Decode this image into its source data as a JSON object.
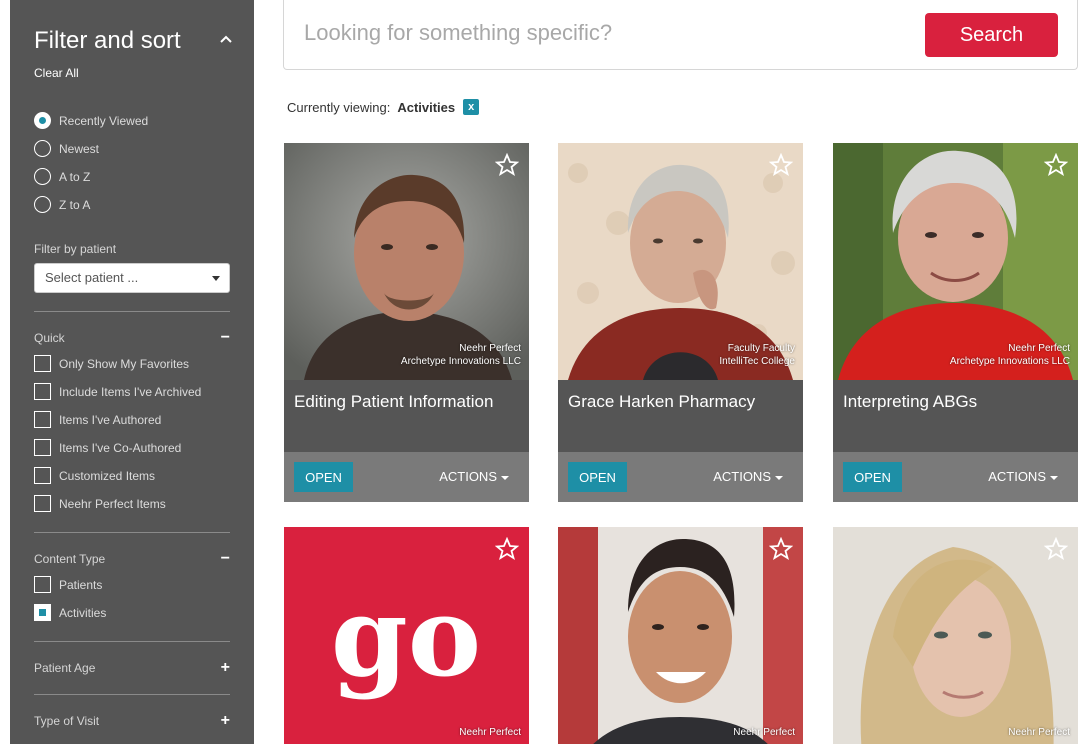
{
  "sidebar": {
    "title": "Filter and sort",
    "clear_all": "Clear All",
    "sort_options": [
      {
        "label": "Recently Viewed",
        "selected": true
      },
      {
        "label": "Newest",
        "selected": false
      },
      {
        "label": "A to Z",
        "selected": false
      },
      {
        "label": "Z to A",
        "selected": false
      }
    ],
    "patient_filter_label": "Filter by patient",
    "patient_select_value": "Select patient ...",
    "quick": {
      "label": "Quick",
      "toggle": "−",
      "items": [
        {
          "label": "Only Show My Favorites",
          "checked": false
        },
        {
          "label": "Include Items I've Archived",
          "checked": false
        },
        {
          "label": "Items I've Authored",
          "checked": false
        },
        {
          "label": "Items I've Co-Authored",
          "checked": false
        },
        {
          "label": "Customized Items",
          "checked": false
        },
        {
          "label": "Neehr Perfect Items",
          "checked": false
        }
      ]
    },
    "content_type": {
      "label": "Content Type",
      "toggle": "−",
      "items": [
        {
          "label": "Patients",
          "checked": false
        },
        {
          "label": "Activities",
          "checked": true
        }
      ]
    },
    "patient_age": {
      "label": "Patient Age",
      "toggle": "+"
    },
    "type_of_visit": {
      "label": "Type of Visit",
      "toggle": "+"
    }
  },
  "search": {
    "placeholder": "Looking for something specific?",
    "button_label": "Search"
  },
  "viewing": {
    "prefix": "Currently viewing:",
    "value": "Activities",
    "remove": "x"
  },
  "cards": [
    {
      "title": "Editing Patient Information",
      "credit_line1": "Neehr Perfect",
      "credit_line2": "Archetype Innovations LLC",
      "open": "OPEN",
      "actions": "ACTIONS"
    },
    {
      "title": "Grace Harken Pharmacy",
      "credit_line1": "Faculty Faculty",
      "credit_line2": "IntelliTec College",
      "open": "OPEN",
      "actions": "ACTIONS"
    },
    {
      "title": "Interpreting ABGs",
      "credit_line1": "Neehr Perfect",
      "credit_line2": "Archetype Innovations LLC",
      "open": "OPEN",
      "actions": "ACTIONS"
    },
    {
      "image_text": "go",
      "credit_line1": "Neehr Perfect"
    },
    {
      "credit_line1": "Neehr Perfect"
    },
    {
      "credit_line1": "Neehr Perfect"
    }
  ],
  "colors": {
    "accent": "#1e8fa6",
    "search_button": "#d9213e",
    "sidebar": "#555555"
  }
}
